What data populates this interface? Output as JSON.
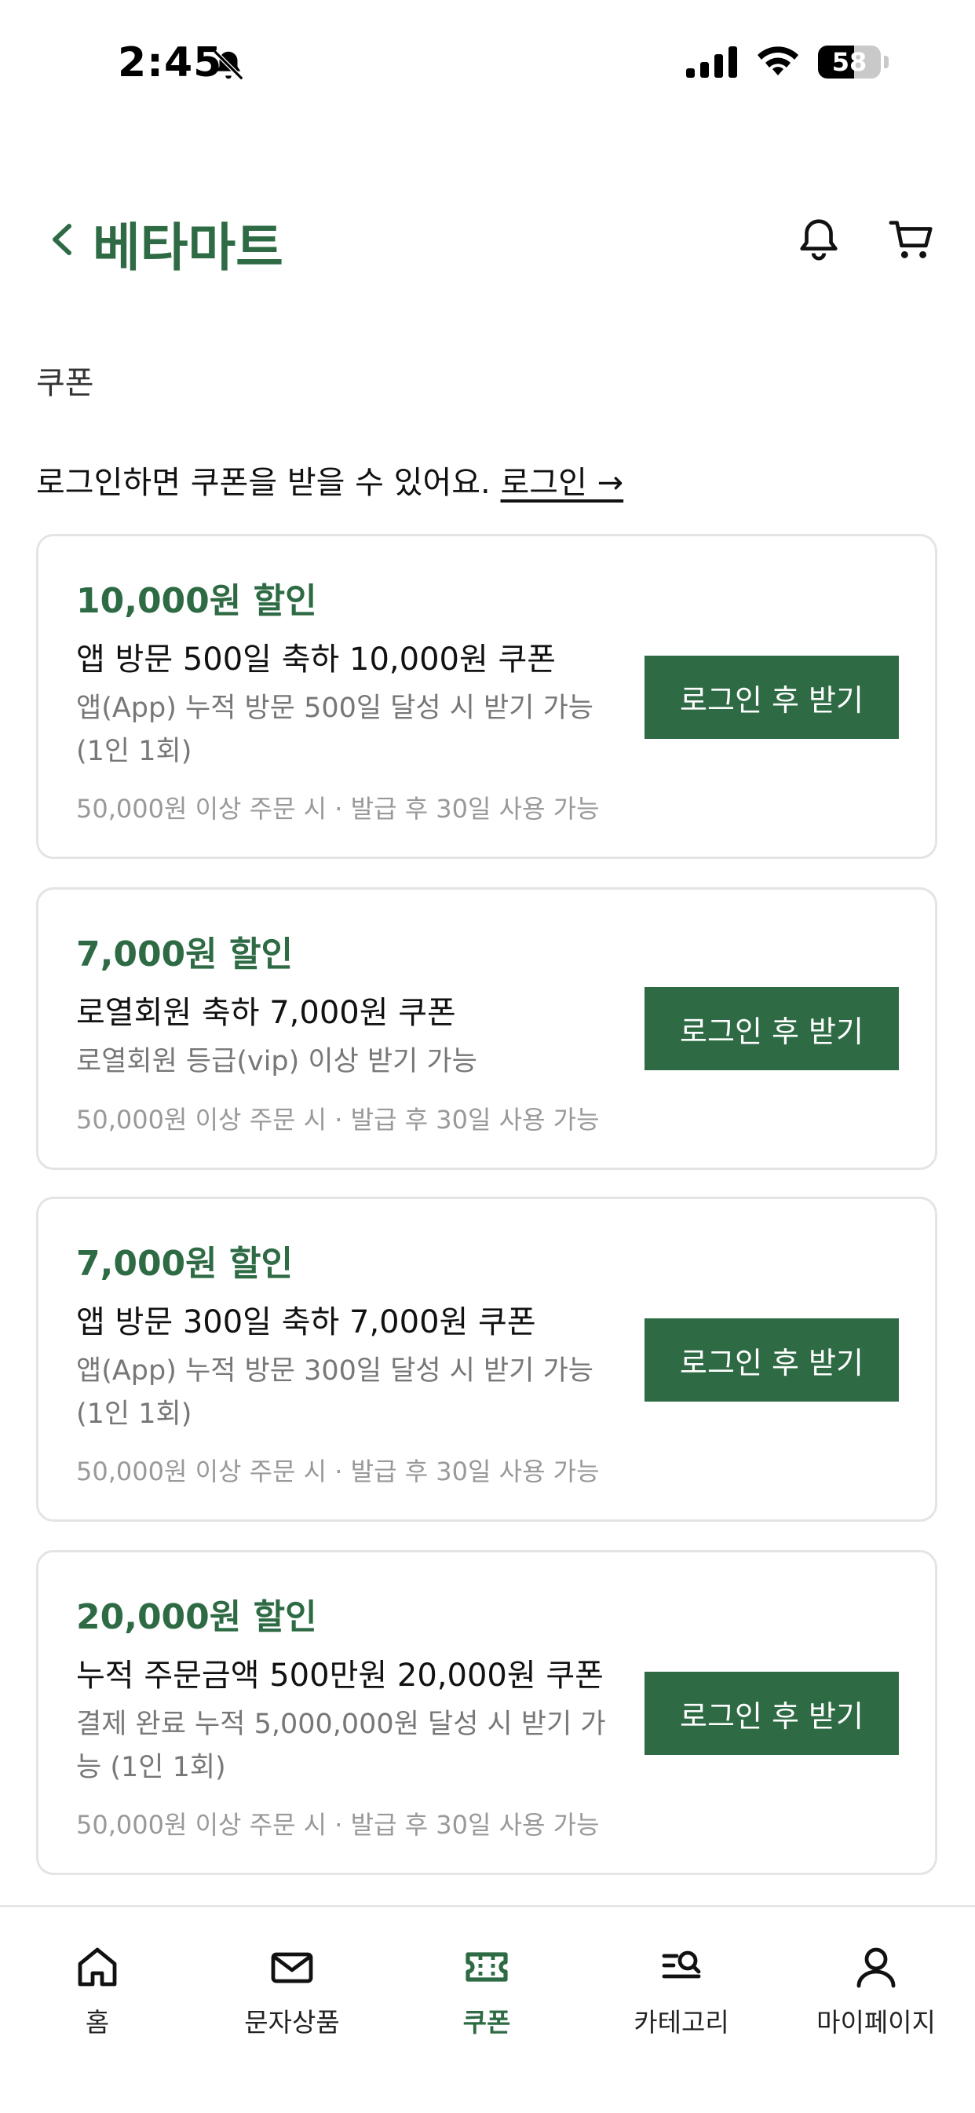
{
  "status_bar": {
    "time": "2:45",
    "battery": "58",
    "battery_level_percent": 58
  },
  "header": {
    "title": "베타마트",
    "back_icon": "chevron-left-icon",
    "notification_icon": "bell-icon",
    "cart_icon": "cart-icon"
  },
  "page": {
    "section_title": "쿠폰",
    "login_prompt": "로그인하면 쿠폰을 받을 수 있어요.",
    "login_link": "로그인 →"
  },
  "coupons": [
    {
      "amount": "10,000원 할인",
      "name": "앱 방문 500일 축하 10,000원 쿠폰",
      "condition": "앱(App) 누적 방문 500일 달성 시 받기 가능 (1인 1회)",
      "terms": "50,000원 이상 주문 시 · 발급 후 30일 사용 가능",
      "button": "로그인 후 받기"
    },
    {
      "amount": "7,000원 할인",
      "name": "로열회원 축하 7,000원 쿠폰",
      "condition": "로열회원 등급(vip) 이상 받기 가능",
      "terms": "50,000원 이상 주문 시 · 발급 후 30일 사용 가능",
      "button": "로그인 후 받기"
    },
    {
      "amount": "7,000원 할인",
      "name": "앱 방문 300일 축하 7,000원 쿠폰",
      "condition": "앱(App) 누적 방문 300일 달성 시 받기 가능 (1인 1회)",
      "terms": "50,000원 이상 주문 시 · 발급 후 30일 사용 가능",
      "button": "로그인 후 받기"
    },
    {
      "amount": "20,000원 할인",
      "name": "누적 주문금액 500만원 20,000원 쿠폰",
      "condition": "결제 완료 누적 5,000,000원 달성 시 받기 가능 (1인 1회)",
      "terms": "50,000원 이상 주문 시 · 발급 후 30일 사용 가능",
      "button": "로그인 후 받기"
    }
  ],
  "bottom_nav": {
    "items": [
      {
        "label": "홈",
        "icon": "home-icon"
      },
      {
        "label": "문자상품",
        "icon": "mail-icon"
      },
      {
        "label": "쿠폰",
        "icon": "ticket-icon",
        "active": true
      },
      {
        "label": "카테고리",
        "icon": "category-search-icon"
      },
      {
        "label": "마이페이지",
        "icon": "person-icon"
      }
    ]
  },
  "colors": {
    "brand": "#2e6b44",
    "muted_text": "#777777",
    "card_border": "#e4e4e4"
  }
}
